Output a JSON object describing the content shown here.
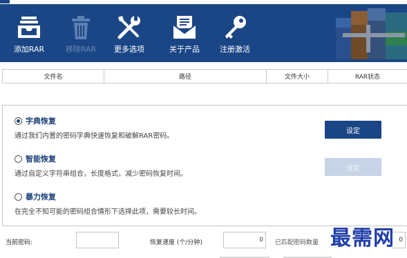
{
  "toolbar": {
    "add": "添加RAR",
    "remove": "移除RAR",
    "more": "更多选项",
    "about": "关于产品",
    "register": "注册激活"
  },
  "table": {
    "columns": [
      "文件名",
      "路径",
      "文件大小",
      "RAR状态"
    ]
  },
  "options": {
    "dictionary": {
      "title": "字典恢复",
      "desc": "通过我们内置的密码字典快速恢复和破解RAR密码。",
      "selected": true
    },
    "smart": {
      "title": "智能恢复",
      "desc": "通过自定义字符串组合，长度格式，减少密码恢复时间。",
      "selected": false
    },
    "brute": {
      "title": "暴力恢复",
      "desc": "在完全不知可能的密码组合情形下选择此项，需要较长时间。",
      "selected": false
    },
    "set_button": "设定"
  },
  "status": {
    "current_password_label": "当前密码:",
    "current_password_value": "",
    "speed_label": "恢复速度 (个/分钟)",
    "speed_value": "0",
    "matched_label": "已匹配密码数量",
    "matched_value": "0"
  },
  "watermark": "最需网",
  "colors": {
    "toolbar_bg": "#1b4686",
    "button_primary": "#1b4686",
    "button_disabled": "#c7d3e6",
    "option_title": "#1b3f78"
  }
}
